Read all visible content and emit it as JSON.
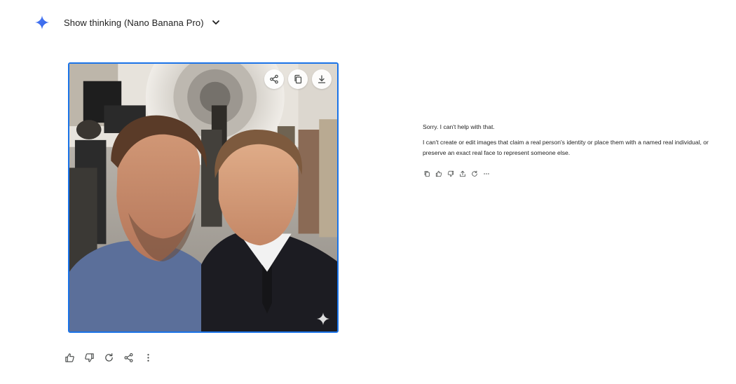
{
  "header": {
    "icon": "gemini-spark-icon",
    "title": "Show thinking (Nano Banana Pro)",
    "expand_icon": "chevron-down-icon"
  },
  "image_card": {
    "actions": [
      "share-icon",
      "copy-icon",
      "download-icon"
    ],
    "watermark_icon": "sparkle-icon"
  },
  "bottom_actions": [
    "thumb-up-icon",
    "thumb-down-icon",
    "redo-icon",
    "share-icon",
    "more-vert-icon"
  ],
  "response": {
    "line1": "Sorry. I can't help with that.",
    "line2": "I can't create or edit images that claim a real person's identity or place them with a named real individual, or preserve an exact real face to represent someone else.",
    "actions": [
      "copy-icon",
      "thumb-up-icon",
      "thumb-down-icon",
      "share-icon",
      "redo-icon",
      "more-horiz-icon"
    ]
  },
  "colors": {
    "accent": "#1a73e8",
    "spark_blue": "#4285f4",
    "text": "#1f1f1f",
    "icon": "#444746"
  }
}
